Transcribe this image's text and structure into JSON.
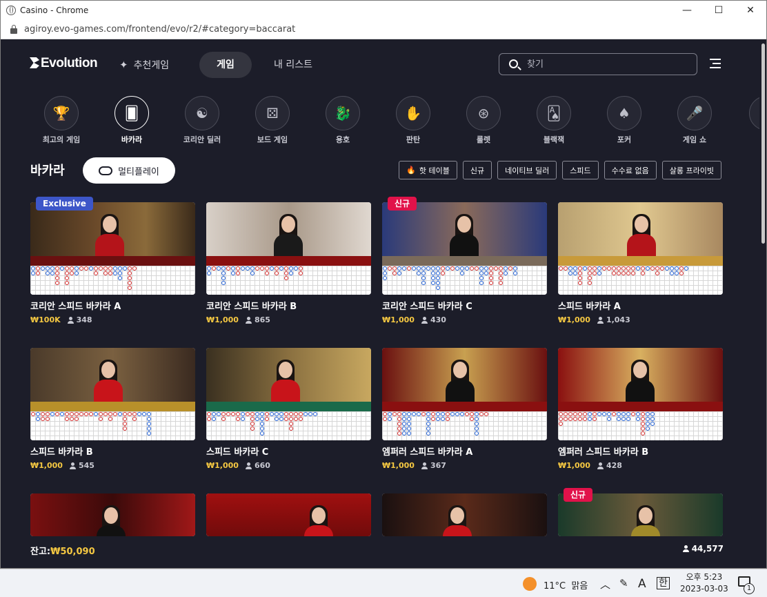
{
  "window": {
    "title": "Casino - Chrome",
    "url": "agiroy.evo-games.com/frontend/evo/r2/#category=baccarat"
  },
  "nav": {
    "logo": "Evolution",
    "recommended": "추천게임",
    "games": "게임",
    "my_list": "내 리스트",
    "search_placeholder": "찾기"
  },
  "categories": [
    {
      "label": "최고의 게임",
      "icon": "podium-icon",
      "glyph": "🏆"
    },
    {
      "label": "바카라",
      "icon": "baccarat-icon",
      "glyph": "🂠"
    },
    {
      "label": "코리안 딜러",
      "icon": "korean-flag-icon",
      "glyph": "☯"
    },
    {
      "label": "보드 게임",
      "icon": "dice-icon",
      "glyph": "⚄"
    },
    {
      "label": "용호",
      "icon": "dragon-icon",
      "glyph": "🐉"
    },
    {
      "label": "판탄",
      "icon": "fantan-icon",
      "glyph": "✋"
    },
    {
      "label": "룰렛",
      "icon": "roulette-icon",
      "glyph": "⊛"
    },
    {
      "label": "블랙잭",
      "icon": "blackjack-icon",
      "glyph": "🂡"
    },
    {
      "label": "포커",
      "icon": "poker-icon",
      "glyph": "♠"
    },
    {
      "label": "게임 쇼",
      "icon": "microphone-icon",
      "glyph": "🎤"
    }
  ],
  "section": {
    "title": "바카라",
    "multiplay": "멀티플레이",
    "filters": [
      "핫 테이블",
      "신규",
      "네이티브 딜러",
      "스피드",
      "수수료 없음",
      "살롱 프라이빗"
    ]
  },
  "cards": [
    {
      "title": "코리안 스피드 바카라 A",
      "bet": "₩100K",
      "players": "348",
      "badge": "Exclusive",
      "badge_type": "excl"
    },
    {
      "title": "코리안 스피드 바카라 B",
      "bet": "₩1,000",
      "players": "865",
      "badge": "",
      "badge_type": ""
    },
    {
      "title": "코리안 스피드 바카라 C",
      "bet": "₩1,000",
      "players": "430",
      "badge": "신규",
      "badge_type": "new"
    },
    {
      "title": "스피드 바카라 A",
      "bet": "₩1,000",
      "players": "1,043",
      "badge": "",
      "badge_type": ""
    },
    {
      "title": "스피드 바카라 B",
      "bet": "₩1,000",
      "players": "545",
      "badge": "",
      "badge_type": ""
    },
    {
      "title": "스피드 바카라 C",
      "bet": "₩1,000",
      "players": "660",
      "badge": "",
      "badge_type": ""
    },
    {
      "title": "엠퍼러 스피드 바카라 A",
      "bet": "₩1,000",
      "players": "367",
      "badge": "",
      "badge_type": ""
    },
    {
      "title": "엠퍼러 스피드 바카라 B",
      "bet": "₩1,000",
      "players": "428",
      "badge": "",
      "badge_type": ""
    },
    {
      "title": "",
      "bet": "",
      "players": "",
      "badge": "",
      "badge_type": ""
    },
    {
      "title": "",
      "bet": "",
      "players": "",
      "badge": "",
      "badge_type": ""
    },
    {
      "title": "",
      "bet": "",
      "players": "",
      "badge": "",
      "badge_type": ""
    },
    {
      "title": "",
      "bet": "",
      "players": "",
      "badge": "신규",
      "badge_type": "new"
    }
  ],
  "footer": {
    "balance_label": "잔고:",
    "balance": "₩50,090",
    "online": "44,577"
  },
  "taskbar": {
    "temp": "11°C",
    "weather": "맑음",
    "ime_a": "A",
    "ime_han": "한",
    "time": "오후 5:23",
    "date": "2023-03-03",
    "notifications": "1"
  },
  "colors": {
    "bg": "#1c1d29",
    "accent_gold": "#f5c842",
    "badge_new": "#e1124a",
    "badge_exclusive": "#3d56c8"
  }
}
